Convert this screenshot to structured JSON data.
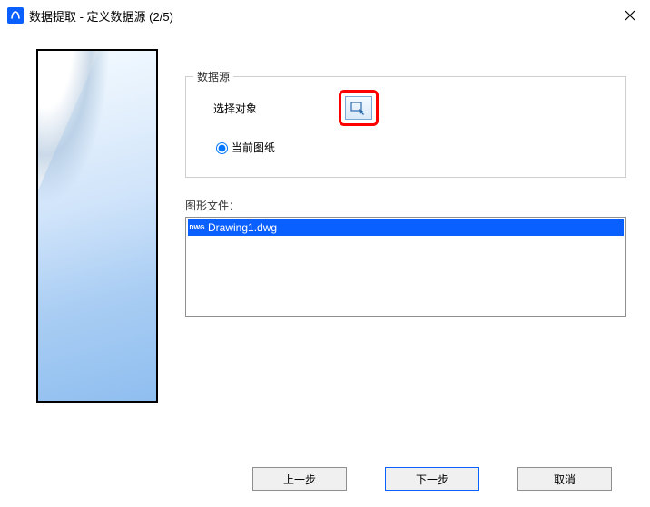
{
  "titlebar": {
    "title": "数据提取 - 定义数据源 (2/5)"
  },
  "dataSource": {
    "legend": "数据源",
    "selectObjects": "选择对象",
    "currentDrawing": "当前图纸"
  },
  "drawingFiles": {
    "label": "图形文件：",
    "items": [
      {
        "name": "Drawing1.dwg",
        "selected": true
      }
    ]
  },
  "buttons": {
    "back": "上一步",
    "next": "下一步",
    "cancel": "取消"
  }
}
